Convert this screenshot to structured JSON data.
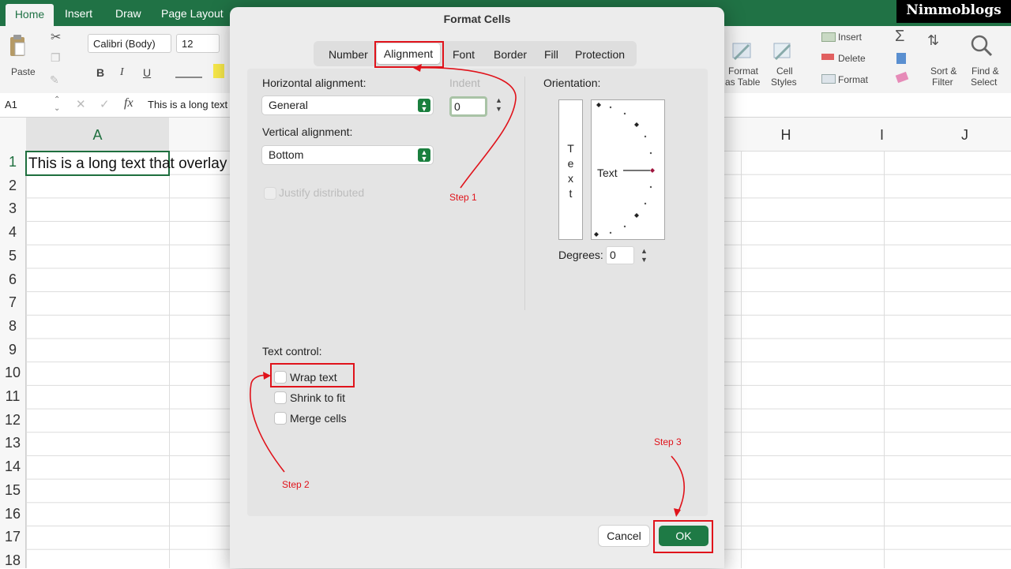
{
  "excel": {
    "tabs": [
      "Home",
      "Insert",
      "Draw",
      "Page Layout"
    ],
    "font_name": "Calibri (Body)",
    "font_size": "12",
    "paste_label": "Paste",
    "bold": "B",
    "italic": "I",
    "underline": "U",
    "cell_ref": "A1",
    "fx": "fx",
    "formula_text": "This is a long text t",
    "columns": [
      "A",
      "H",
      "I",
      "J"
    ],
    "rows": [
      "1",
      "2",
      "3",
      "4",
      "5",
      "6",
      "7",
      "8",
      "9",
      "10",
      "11",
      "12",
      "13",
      "14",
      "15",
      "16",
      "17",
      "18"
    ],
    "cell_a1": "This is a long text that overlay on",
    "right_ribbon": {
      "format_table_l1": "Format",
      "format_table_l2": "as Table",
      "cell_styles_l1": "Cell",
      "cell_styles_l2": "Styles",
      "insert": "Insert",
      "delete": "Delete",
      "format": "Format",
      "sort_l1": "Sort &",
      "sort_l2": "Filter",
      "find_l1": "Find &",
      "find_l2": "Select"
    }
  },
  "watermark": "Nimmoblogs",
  "dialog": {
    "title": "Format Cells",
    "tabs": [
      "Number",
      "Alignment",
      "Font",
      "Border",
      "Fill",
      "Protection"
    ],
    "horizontal_label": "Horizontal alignment:",
    "horizontal_value": "General",
    "indent_label": "Indent",
    "indent_value": "0",
    "vertical_label": "Vertical alignment:",
    "vertical_value": "Bottom",
    "justify_label": "Justify distributed",
    "orientation_label": "Orientation:",
    "vertical_text": [
      "T",
      "e",
      "x",
      "t"
    ],
    "rotation_text": "Text",
    "degrees_label": "Degrees:",
    "degrees_value": "0",
    "text_control_label": "Text control:",
    "wrap_text": "Wrap text",
    "shrink_to_fit": "Shrink to fit",
    "merge_cells": "Merge cells",
    "cancel": "Cancel",
    "ok": "OK"
  },
  "annotations": {
    "step1": "Step 1",
    "step2": "Step 2",
    "step3": "Step 3",
    "color": "#e0131b"
  },
  "colors": {
    "excel_green": "#207245",
    "ok_button": "#1e7a45",
    "select_arrow": "#1a7f3e"
  }
}
